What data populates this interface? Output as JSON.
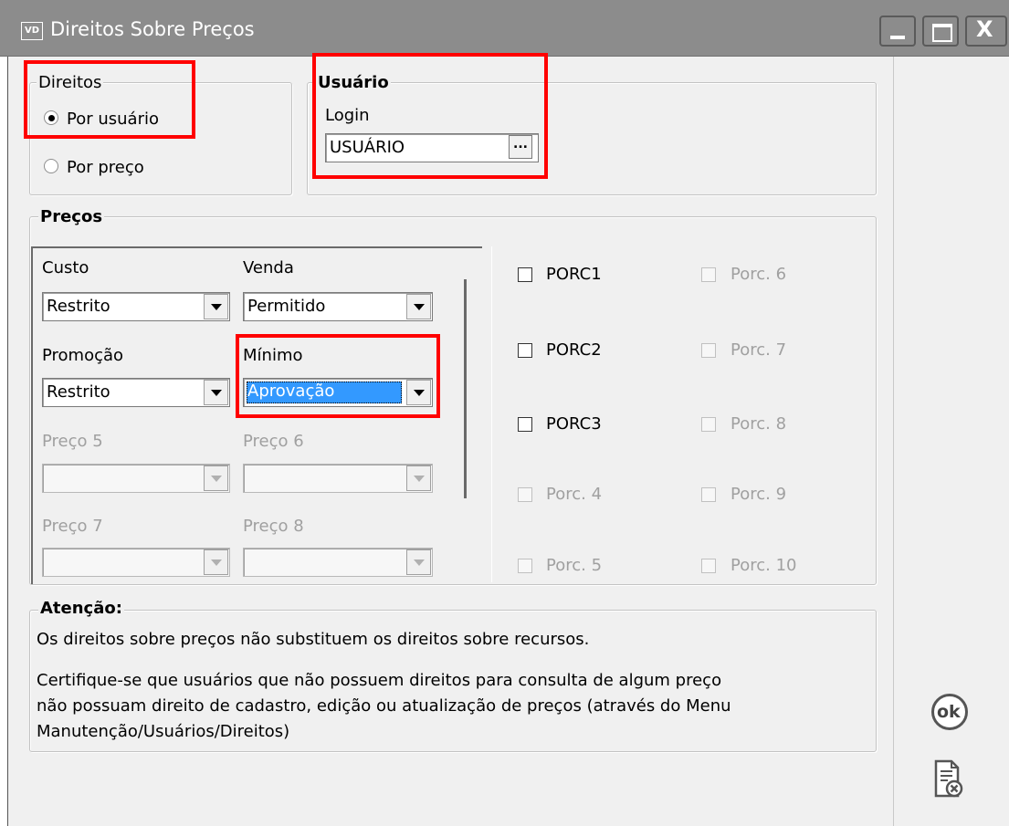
{
  "window": {
    "app_icon": "VD",
    "title": "Direitos Sobre Preços",
    "controls": [
      "minimize-icon",
      "maximize-icon",
      "close-icon"
    ]
  },
  "direitos": {
    "legend": "Direitos",
    "options": [
      {
        "label": "Por usuário",
        "selected": true
      },
      {
        "label": "Por preço",
        "selected": false
      }
    ]
  },
  "usuario": {
    "legend": "Usuário",
    "login_label": "Login",
    "login_value": "USUÁRIO",
    "browse_label": "..."
  },
  "precos": {
    "legend": "Preços",
    "fields": [
      {
        "label": "Custo",
        "value": "Restrito",
        "enabled": true
      },
      {
        "label": "Venda",
        "value": "Permitido",
        "enabled": true
      },
      {
        "label": "Promoção",
        "value": "Restrito",
        "enabled": true
      },
      {
        "label": "Mínimo",
        "value": "Aprovação",
        "enabled": true,
        "focused": true
      },
      {
        "label": "Preço 5",
        "value": "",
        "enabled": false
      },
      {
        "label": "Preço 6",
        "value": "",
        "enabled": false
      },
      {
        "label": "Preço 7",
        "value": "",
        "enabled": false
      },
      {
        "label": "Preço 8",
        "value": "",
        "enabled": false
      }
    ],
    "checkboxes": [
      {
        "label": "PORC1",
        "enabled": true,
        "checked": false
      },
      {
        "label": "Porc. 6",
        "enabled": false,
        "checked": false
      },
      {
        "label": "PORC2",
        "enabled": true,
        "checked": false
      },
      {
        "label": "Porc. 7",
        "enabled": false,
        "checked": false
      },
      {
        "label": "PORC3",
        "enabled": true,
        "checked": false
      },
      {
        "label": "Porc. 8",
        "enabled": false,
        "checked": false
      },
      {
        "label": "Porc. 4",
        "enabled": false,
        "checked": false
      },
      {
        "label": "Porc. 9",
        "enabled": false,
        "checked": false
      },
      {
        "label": "Porc. 5",
        "enabled": false,
        "checked": false
      },
      {
        "label": "Porc. 10",
        "enabled": false,
        "checked": false
      }
    ]
  },
  "atencao": {
    "legend": "Atenção:",
    "line1": "Os direitos sobre preços não substituem os direitos sobre recursos.",
    "line2": "Certifique-se que usuários que não possuem direitos para consulta de algum preço",
    "line3": "não possuam direito de cadastro, edição ou atualização de preços (através do Menu",
    "line4": "Manutenção/Usuários/Direitos)"
  },
  "side": {
    "ok_label": "ok",
    "cancel_icon": "cancel-document-icon"
  },
  "colors": {
    "highlight_red": "#ff0000",
    "titlebar": "#8c8c8c",
    "selection_blue": "#3399ff"
  }
}
